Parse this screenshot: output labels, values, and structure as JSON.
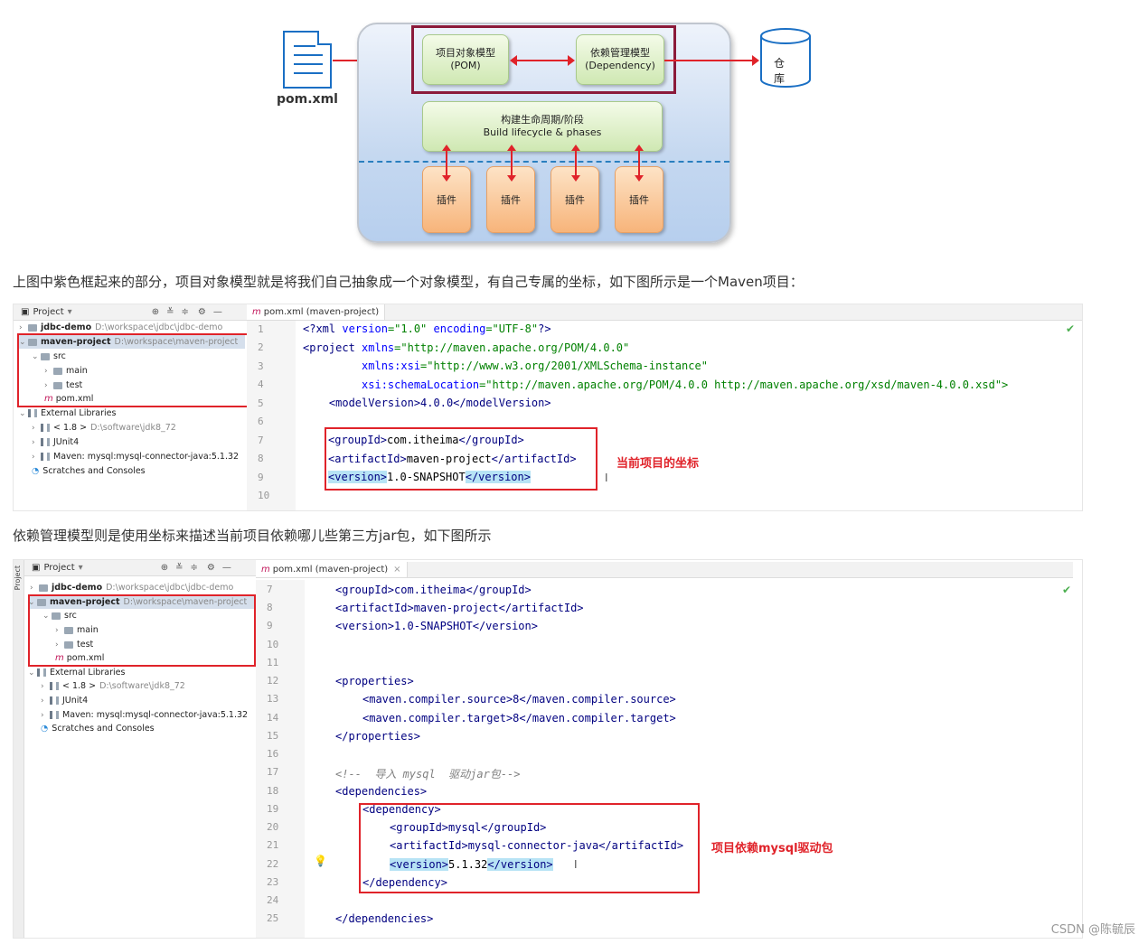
{
  "diagram": {
    "pom_xml_label": "pom.xml",
    "pom_model_title": "项目对象模型",
    "pom_model_sub": "(POM)",
    "dependency_model_title": "依赖管理模型",
    "dependency_model_sub": "(Dependency)",
    "lifecycle_title": "构建生命周期/阶段",
    "lifecycle_sub": "Build lifecycle & phases",
    "plugin_label": "插件",
    "warehouse_label": "仓库"
  },
  "paragraph1": "上图中紫色框起来的部分，项目对象模型就是将我们自己抽象成一个对象模型，有自己专属的坐标，如下图所示是一个Maven项目：",
  "paragraph2": "依赖管理模型则是使用坐标来描述当前项目依赖哪儿些第三方jar包，如下图所示",
  "ide": {
    "project_label": "Project",
    "tab_label": "pom.xml (maven-project)",
    "side_tab_project": "Project",
    "tree": {
      "jdbc_demo": "jdbc-demo",
      "jdbc_demo_path": "D:\\workspace\\jdbc\\jdbc-demo",
      "maven_project": "maven-project",
      "maven_project_path": "D:\\workspace\\maven-project",
      "src": "src",
      "main": "main",
      "test": "test",
      "pom_xml": "pom.xml",
      "external_libraries": "External Libraries",
      "jdk": "< 1.8 >",
      "jdk_path": "D:\\software\\jdk8_72",
      "junit": "JUnit4",
      "mysql_lib": "Maven: mysql:mysql-connector-java:5.1.32",
      "scratches": "Scratches and Consoles"
    },
    "code1": {
      "line_numbers": [
        "1",
        "2",
        "3",
        "4",
        "5",
        "6",
        "7",
        "8",
        "9",
        "10"
      ],
      "l1_a": "<?",
      "l1_b": "xml",
      "l1_c": " version",
      "l1_d": "=\"1.0\"",
      "l1_e": " encoding",
      "l1_f": "=\"UTF-8\"",
      "l1_g": "?>",
      "l2_a": "<project",
      "l2_b": " xmlns",
      "l2_c": "=\"http://maven.apache.org/POM/4.0.0\"",
      "l3_a": "         xmlns:xsi",
      "l3_b": "=\"http://www.w3.org/2001/XMLSchema-instance\"",
      "l4_a": "         xsi:schemaLocation",
      "l4_b": "=\"http://maven.apache.org/POM/4.0.0 http://maven.apache.org/xsd/maven-4.0.0.xsd\">",
      "l5": "    <modelVersion>4.0.0</modelVersion>",
      "l7_open": "<groupId>",
      "l7_text": "com.itheima",
      "l7_close": "</groupId>",
      "l8_open": "<artifactId>",
      "l8_text": "maven-project",
      "l8_close": "</artifactId>",
      "l9_open": "<version>",
      "l9_text": "1.0-SNAPSHOT",
      "l9_close": "</version>",
      "annotation": "当前项目的坐标"
    },
    "code2": {
      "line_numbers": [
        "7",
        "8",
        "9",
        "10",
        "11",
        "12",
        "13",
        "14",
        "15",
        "16",
        "17",
        "18",
        "19",
        "20",
        "21",
        "22",
        "23",
        "24",
        "25"
      ],
      "l7": "<groupId>com.itheima</groupId>",
      "l8": "<artifactId>maven-project</artifactId>",
      "l9": "<version>1.0-SNAPSHOT</version>",
      "l12": "<properties>",
      "l13": "<maven.compiler.source>8</maven.compiler.source>",
      "l14": "<maven.compiler.target>8</maven.compiler.target>",
      "l15": "</properties>",
      "l17": "<!--  导入 mysql  驱动jar包-->",
      "l18": "<dependencies>",
      "l19": "<dependency>",
      "l20": "<groupId>mysql</groupId>",
      "l21": "<artifactId>mysql-connector-java</artifactId>",
      "l22_open": "<version>",
      "l22_text": "5.1.32",
      "l22_close": "</version>",
      "l23": "</dependency>",
      "l25": "</dependencies>",
      "annotation": "项目依赖mysql驱动包"
    }
  },
  "watermark": "CSDN @陈毓辰",
  "colors": {
    "red_frame": "#e0232a",
    "purple_frame": "#8b1a3a",
    "accent_blue": "#1a6fc4"
  }
}
